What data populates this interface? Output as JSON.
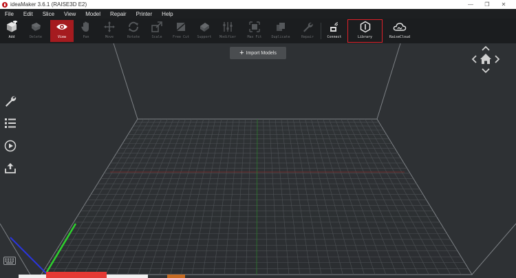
{
  "window": {
    "title": "ideaMaker 3.6.1 (RAISE3D E2)",
    "controls": [
      "—",
      "❐",
      "✕"
    ]
  },
  "menu": [
    "File",
    "Edit",
    "Slice",
    "View",
    "Model",
    "Repair",
    "Printer",
    "Help"
  ],
  "toolbar": {
    "items": [
      {
        "label": "Add",
        "icon": "add-cube-icon",
        "state": "enabled"
      },
      {
        "label": "Delete",
        "icon": "delete-icon",
        "state": "disabled"
      },
      {
        "label": "View",
        "icon": "eye-icon",
        "state": "active"
      },
      {
        "label": "Pan",
        "icon": "hand-icon",
        "state": "disabled"
      },
      {
        "label": "Move",
        "icon": "move-arrows-icon",
        "state": "disabled"
      },
      {
        "label": "Rotate",
        "icon": "rotate-icon",
        "state": "disabled"
      },
      {
        "label": "Scale",
        "icon": "scale-icon",
        "state": "disabled"
      },
      {
        "label": "Free Cut",
        "icon": "free-cut-icon",
        "state": "disabled"
      },
      {
        "label": "Support",
        "icon": "support-icon",
        "state": "disabled"
      },
      {
        "label": "Modifier",
        "icon": "modifier-icon",
        "state": "disabled"
      },
      {
        "label": "Max Fit",
        "icon": "max-fit-icon",
        "state": "disabled"
      },
      {
        "label": "Duplicate",
        "icon": "duplicate-icon",
        "state": "disabled"
      },
      {
        "label": "Repair",
        "icon": "repair-icon",
        "state": "disabled"
      },
      {
        "label": "Connect",
        "icon": "connect-icon",
        "state": "enabled"
      },
      {
        "label": "Library",
        "icon": "library-icon",
        "state": "highlight"
      },
      {
        "label": "RaiseCloud",
        "icon": "cloud-icon",
        "state": "enabled"
      }
    ]
  },
  "viewport": {
    "import_label": "Import Models",
    "side_tools": [
      "wrench-icon",
      "list-icon",
      "play-icon",
      "upload-icon"
    ],
    "nav_icons": [
      "up-arrow-icon",
      "left-arrow-icon",
      "home-icon",
      "right-arrow-icon",
      "down-arrow-icon"
    ],
    "keyboard_icon": "keyboard-icon"
  },
  "colors": {
    "accent": "#a51b1f",
    "highlight": "#e0202a",
    "axis_x": "#e53935",
    "axis_y": "#2ed12e",
    "axis_z": "#2a35e0"
  }
}
